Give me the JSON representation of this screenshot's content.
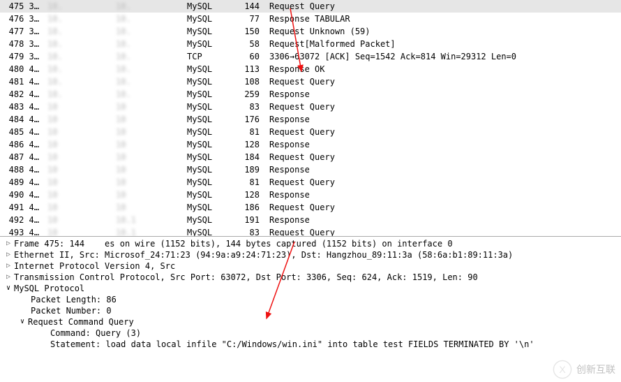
{
  "rows": [
    {
      "no": "475",
      "time": "3…",
      "src": "10.",
      "dst": "10.",
      "proto": "MySQL",
      "len": "144",
      "info": "Request Query",
      "sel": true
    },
    {
      "no": "476",
      "time": "3…",
      "src": "10.",
      "dst": "10.",
      "proto": "MySQL",
      "len": "77",
      "info": "Response TABULAR",
      "sel": false
    },
    {
      "no": "477",
      "time": "3…",
      "src": "10.",
      "dst": "10.",
      "proto": "MySQL",
      "len": "150",
      "info": "Request Unknown (59)",
      "sel": false
    },
    {
      "no": "478",
      "time": "3…",
      "src": "10.",
      "dst": "10.",
      "proto": "MySQL",
      "len": "58",
      "info": "Request[Malformed Packet]",
      "sel": false
    },
    {
      "no": "479",
      "time": "3…",
      "src": "10.",
      "dst": "10.",
      "proto": "TCP",
      "len": "60",
      "info": "3306→63072 [ACK] Seq=1542 Ack=814 Win=29312 Len=0",
      "sel": false
    },
    {
      "no": "480",
      "time": "4…",
      "src": "10.",
      "dst": "10.",
      "proto": "MySQL",
      "len": "113",
      "info": "Response OK",
      "sel": false
    },
    {
      "no": "481",
      "time": "4…",
      "src": "10.",
      "dst": "10.",
      "proto": "MySQL",
      "len": "108",
      "info": "Request Query",
      "sel": false
    },
    {
      "no": "482",
      "time": "4…",
      "src": "10.",
      "dst": "10.",
      "proto": "MySQL",
      "len": "259",
      "info": "Response",
      "sel": false
    },
    {
      "no": "483",
      "time": "4…",
      "src": "10",
      "dst": "10",
      "proto": "MySQL",
      "len": "83",
      "info": "Request Query",
      "sel": false
    },
    {
      "no": "484",
      "time": "4…",
      "src": "10",
      "dst": "10",
      "proto": "MySQL",
      "len": "176",
      "info": "Response",
      "sel": false
    },
    {
      "no": "485",
      "time": "4…",
      "src": "10",
      "dst": "10",
      "proto": "MySQL",
      "len": "81",
      "info": "Request Query",
      "sel": false
    },
    {
      "no": "486",
      "time": "4…",
      "src": "10",
      "dst": "10",
      "proto": "MySQL",
      "len": "128",
      "info": "Response",
      "sel": false
    },
    {
      "no": "487",
      "time": "4…",
      "src": "10",
      "dst": "10",
      "proto": "MySQL",
      "len": "184",
      "info": "Request Query",
      "sel": false
    },
    {
      "no": "488",
      "time": "4…",
      "src": "10",
      "dst": "10",
      "proto": "MySQL",
      "len": "189",
      "info": "Response",
      "sel": false
    },
    {
      "no": "489",
      "time": "4…",
      "src": "10",
      "dst": "10",
      "proto": "MySQL",
      "len": "81",
      "info": "Request Query",
      "sel": false
    },
    {
      "no": "490",
      "time": "4…",
      "src": "10",
      "dst": "10",
      "proto": "MySQL",
      "len": "128",
      "info": "Response",
      "sel": false
    },
    {
      "no": "491",
      "time": "4…",
      "src": "10",
      "dst": "10",
      "proto": "MySQL",
      "len": "186",
      "info": "Request Query",
      "sel": false
    },
    {
      "no": "492",
      "time": "4…",
      "src": "10",
      "dst": "10.1",
      "proto": "MySQL",
      "len": "191",
      "info": "Response",
      "sel": false
    },
    {
      "no": "493",
      "time": "4…",
      "src": "10",
      "dst": "10.1",
      "proto": "MySQL",
      "len": "83",
      "info": "Request Query",
      "sel": false
    }
  ],
  "tree": {
    "frame": "Frame 475: 144    es on wire (1152 bits), 144 bytes captured (1152 bits) on interface 0",
    "eth": "Ethernet II, Src: Microsof_24:71:23 (94:9a:a9:24:71:23), Dst: Hangzhou_89:11:3a (58:6a:b1:89:11:3a)",
    "ip": "Internet Protocol Version 4, Src",
    "tcp": "Transmission Control Protocol, Src Port: 63072, Dst Port: 3306, Seq: 624, Ack: 1519, Len: 90",
    "mysql": "MySQL Protocol",
    "pktlen": "Packet Length: 86",
    "pktnum": "Packet Number: 0",
    "reqcmd": "Request Command Query",
    "cmd": "Command: Query (3)",
    "stmt": "Statement: load data local infile \"C:/Windows/win.ini\" into table test FIELDS TERMINATED BY '\\n'"
  },
  "watermark": "创新互联"
}
